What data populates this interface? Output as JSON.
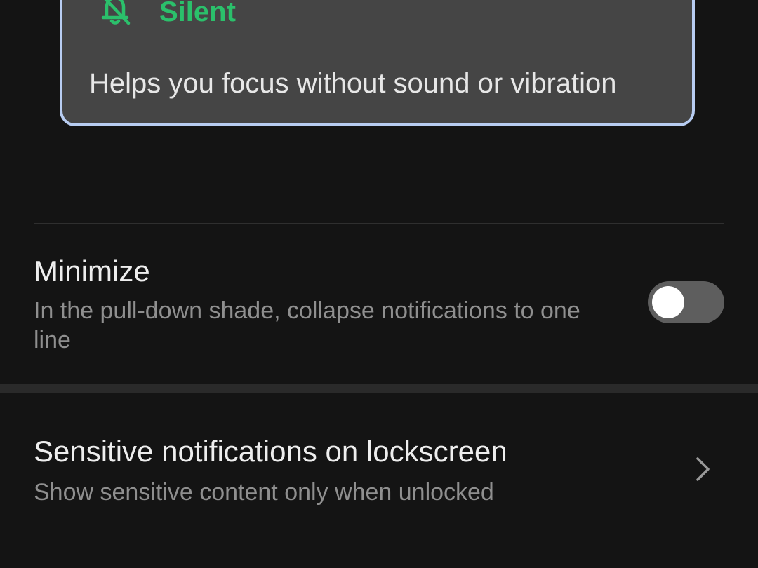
{
  "silent_option": {
    "title": "Silent",
    "description": "Helps you focus without sound or vibration",
    "icon": "bell-off-icon",
    "accent_color": "#2bc06b",
    "selected_border_color": "#b8cdf2"
  },
  "minimize": {
    "title": "Minimize",
    "description": "In the pull-down shade, collapse notifications to one line",
    "toggle_on": false
  },
  "sensitive_lockscreen": {
    "title": "Sensitive notifications on lockscreen",
    "description": "Show sensitive content only when unlocked",
    "icon": "chevron-right-icon"
  }
}
